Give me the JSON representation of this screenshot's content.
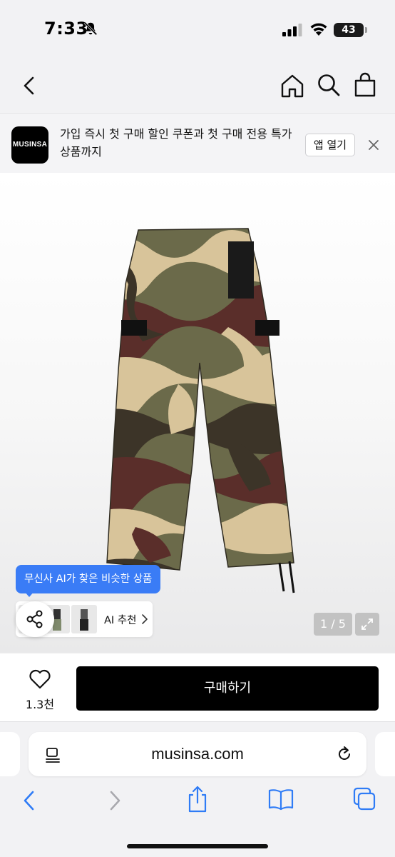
{
  "status_bar": {
    "time": "7:33",
    "battery": "43"
  },
  "nav": {
    "icons": [
      "back-icon",
      "home-icon",
      "search-icon",
      "shopping-bag-icon"
    ]
  },
  "app_banner": {
    "logo_text": "MUSINSA",
    "message": "가입 즉시 첫 구매 할인 쿠폰과 첫 구매 전용 특가 상품까지",
    "open_app_label": "앱 열기"
  },
  "product": {
    "image_description_icon": "camo-cargo-pants",
    "ai_tooltip": "무신사 AI가 찾은 비슷한 상품",
    "ai_reco_label": "AI 추천",
    "page_counter": "1 / 5"
  },
  "purchase": {
    "like_count": "1.3천",
    "buy_label": "구매하기"
  },
  "browser": {
    "url": "musinsa.com"
  },
  "colors": {
    "accent_blue": "#3a7cf6",
    "buy_button": "#000000"
  }
}
